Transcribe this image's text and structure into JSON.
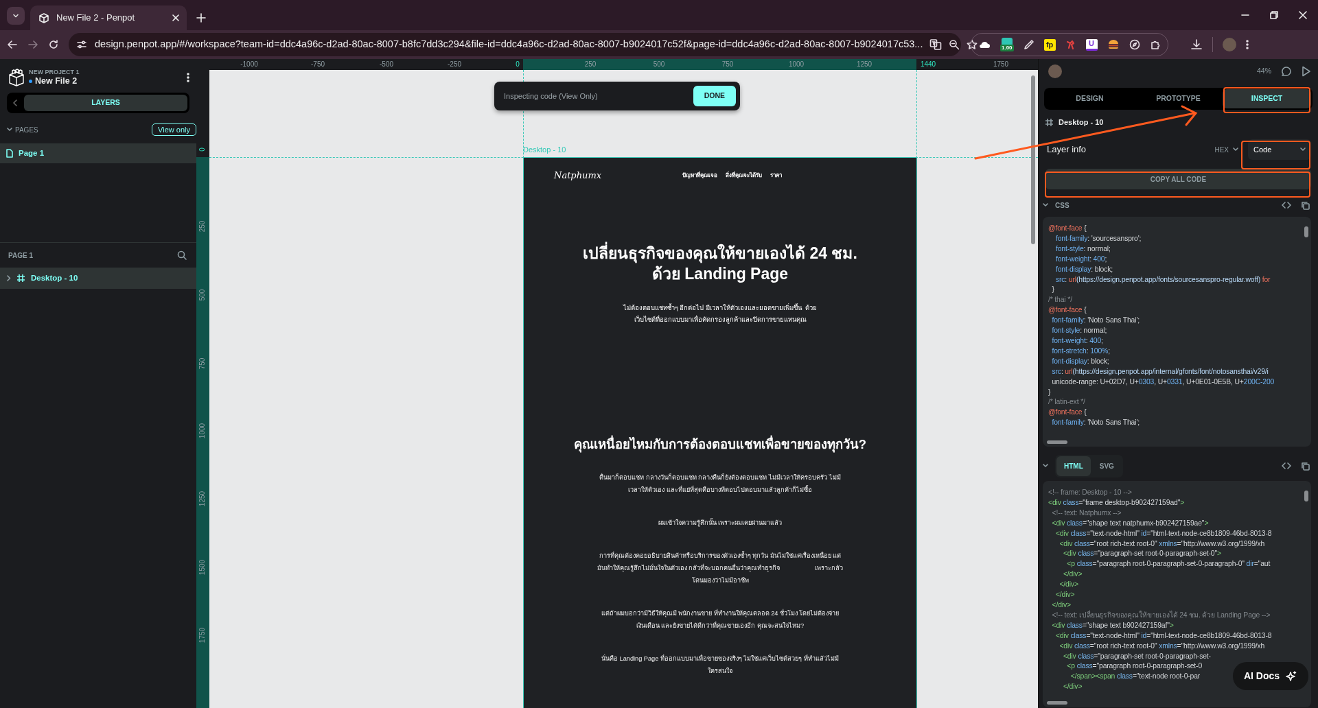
{
  "browser": {
    "tab_title": "New File 2 - Penpot",
    "url": "design.penpot.app/#/workspace?team-id=ddc4a96c-d2ad-80ac-8007-b8fc7dd3c294&file-id=ddc4a96c-d2ad-80ac-8007-b9024017c52f&page-id=ddc4a96c-d2ad-80ac-8007-b9024017c53...",
    "extension_badge": "1.00",
    "extension_fp": "fp",
    "extension_u": "U"
  },
  "sidebar": {
    "project": "NEW PROJECT 1",
    "file": "New File 2",
    "panel_tab": "LAYERS",
    "pages_label": "PAGES",
    "view_only": "View only",
    "pages": [
      {
        "name": "Page 1",
        "selected": true
      }
    ],
    "layers_title": "PAGE 1",
    "layers": [
      {
        "name": "Desktop - 10",
        "expanded": false,
        "selected": true
      }
    ]
  },
  "rulers": {
    "horizontal": [
      {
        "text": "-1000",
        "highlighted": false
      },
      {
        "text": "-750",
        "highlighted": false
      },
      {
        "text": "-500",
        "highlighted": false
      },
      {
        "text": "-250",
        "highlighted": false
      },
      {
        "text": "0",
        "highlighted": true
      },
      {
        "text": "250",
        "highlighted": false
      },
      {
        "text": "500",
        "highlighted": false
      },
      {
        "text": "750",
        "highlighted": false
      },
      {
        "text": "1000",
        "highlighted": false
      },
      {
        "text": "1250",
        "highlighted": false
      },
      {
        "text": "1440",
        "highlighted": true
      },
      {
        "text": "1750",
        "highlighted": false
      }
    ],
    "vertical": [
      {
        "text": "0",
        "highlighted": true
      },
      {
        "text": "250",
        "highlighted": false
      },
      {
        "text": "500",
        "highlighted": false
      },
      {
        "text": "750",
        "highlighted": false
      },
      {
        "text": "1000",
        "highlighted": false
      },
      {
        "text": "1250",
        "highlighted": false
      },
      {
        "text": "1500",
        "highlighted": false
      },
      {
        "text": "1750",
        "highlighted": false
      }
    ]
  },
  "canvas": {
    "toast": {
      "message": "Inspecting code (View Only)",
      "button": "DONE"
    },
    "frame": {
      "label": "Desktop - 10",
      "logo": "Natphumx",
      "nav": [
        "ปัญหาที่คุณเจอ",
        "สิ่งที่คุณจะได้รับ",
        "ราคา"
      ],
      "headline": "เปลี่ยนธุรกิจของคุณให้ขายเองได้ 24 ชม.\nด้วย Landing Page",
      "intro": "ไม่ต้องตอบแชทซ้ำๆ อีกต่อไป มีเวลาให้ตัวเองและยอดขายเพิ่มขึ้น  ด้วย\nเว็บไซต์ที่ออกแบบมาเพื่อคัดกรองลูกค้าและปิดการขายแทนคุณ",
      "heading": "คุณเหนื่อยไหมกับการต้องตอบแชทเพื่อขายของทุกวัน?",
      "paragraphs": [
        "ตื่นมาก็ตอบแชท กลางวันก็ตอบแชท กลางคืนก็ยังต้องตอบแชท ไม่มีเวลาให้ครอบครัว ไม่มี\nเวลาให้ตัวเอง และที่แย่ที่สุดคือบางทีตอบไปตอบมาแล้วลูกค้าก็ไม่ซื้อ",
        "ผมเข้าใจความรู้สึกนั้น เพราะผมเคยผ่านมาแล้ว",
        "การที่คุณต้องคอยอธิบายสินค้าหรือบริการของตัวเองซ้ำๆ ทุกวัน มันไม่ใช่แค่เรื่องเหนื่อย แต่\nมันทำให้คุณรู้สึกไม่มั่นใจในตัวเอง กลัวที่จะบอกคนอื่นว่าคุณทำธุรกิจ                    เพราะกลัว\nโดนมองว่าไม่มีอาชีพ",
        "แต่ถ้าผมบอกว่ามีวิธีให้คุณมี พนักงานขาย ที่ทำงานให้คุณตลอด 24 ชั่วโมง โดยไม่ต้องจ่าย\nเงินเดือน และยังขายได้ดีกว่าที่คุณขายเองอีก คุณจะสนใจไหม?",
        "นั่นคือ Landing Page ที่ออกแบบมาเพื่อขายของจริงๆ ไม่ใช่แค่เว็บไซต์สวยๆ ที่ทำแล้วไม่มี\nใครสนใจ"
      ]
    }
  },
  "inspector": {
    "zoom": "44%",
    "tabs": [
      {
        "label": "DESIGN",
        "selected": false
      },
      {
        "label": "PROTOTYPE",
        "selected": false
      },
      {
        "label": "INSPECT",
        "selected": true
      }
    ],
    "layer_name": "Desktop - 10",
    "layer_info": "Layer info",
    "color_format": "HEX",
    "view_mode": "Code",
    "copy_button": "COPY ALL CODE",
    "css": {
      "label": "CSS",
      "lines": [
        [
          {
            "kind": "at",
            "text": "@font-face"
          },
          {
            "kind": "plain",
            "text": " {"
          }
        ],
        [
          {
            "kind": "prop",
            "text": "    font-family"
          },
          {
            "kind": "plain",
            "text": ": 'sourcesanspro';"
          }
        ],
        [
          {
            "kind": "prop",
            "text": "    font-style"
          },
          {
            "kind": "plain",
            "text": ": normal;"
          }
        ],
        [
          {
            "kind": "prop",
            "text": "    font-weight"
          },
          {
            "kind": "plain",
            "text": ": "
          },
          {
            "kind": "num",
            "text": "400"
          },
          {
            "kind": "plain",
            "text": ";"
          }
        ],
        [
          {
            "kind": "prop",
            "text": "    font-display"
          },
          {
            "kind": "plain",
            "text": ": block;"
          }
        ],
        [
          {
            "kind": "prop",
            "text": "    src"
          },
          {
            "kind": "plain",
            "text": ": "
          },
          {
            "kind": "at",
            "text": "url"
          },
          {
            "kind": "link",
            "text": "(https://design.penpot.app/fonts/sourcesanspro-regular.woff)"
          },
          {
            "kind": "at",
            "text": " for"
          }
        ],
        [
          {
            "kind": "plain",
            "text": "  }"
          }
        ],
        [
          {
            "kind": "comment",
            "text": "/* thai */"
          }
        ],
        [
          {
            "kind": "at",
            "text": "@font-face"
          },
          {
            "kind": "plain",
            "text": " {"
          }
        ],
        [
          {
            "kind": "prop",
            "text": "  font-family"
          },
          {
            "kind": "plain",
            "text": ": 'Noto Sans Thai';"
          }
        ],
        [
          {
            "kind": "prop",
            "text": "  font-style"
          },
          {
            "kind": "plain",
            "text": ": normal;"
          }
        ],
        [
          {
            "kind": "prop",
            "text": "  font-weight"
          },
          {
            "kind": "plain",
            "text": ": "
          },
          {
            "kind": "num",
            "text": "400"
          },
          {
            "kind": "plain",
            "text": ";"
          }
        ],
        [
          {
            "kind": "prop",
            "text": "  font-stretch"
          },
          {
            "kind": "plain",
            "text": ": "
          },
          {
            "kind": "num",
            "text": "100%"
          },
          {
            "kind": "plain",
            "text": ";"
          }
        ],
        [
          {
            "kind": "prop",
            "text": "  font-display"
          },
          {
            "kind": "plain",
            "text": ": block;"
          }
        ],
        [
          {
            "kind": "prop",
            "text": "  src"
          },
          {
            "kind": "plain",
            "text": ": "
          },
          {
            "kind": "at",
            "text": "url"
          },
          {
            "kind": "link",
            "text": "(https://design.penpot.app/internal/gfonts/font/notosansthai/v29/i"
          }
        ],
        [
          {
            "kind": "plain",
            "text": "  unicode-range: U+02D7, U+"
          },
          {
            "kind": "num",
            "text": "0303"
          },
          {
            "kind": "plain",
            "text": ", U+"
          },
          {
            "kind": "num",
            "text": "0331"
          },
          {
            "kind": "plain",
            "text": ", U+0E01-0E5B, U+"
          },
          {
            "kind": "num",
            "text": "200C-200"
          }
        ],
        [
          {
            "kind": "plain",
            "text": "}"
          }
        ],
        [
          {
            "kind": "comment",
            "text": "/* latin-ext */"
          }
        ],
        [
          {
            "kind": "at",
            "text": "@font-face"
          },
          {
            "kind": "plain",
            "text": " {"
          }
        ],
        [
          {
            "kind": "prop",
            "text": "  font-family"
          },
          {
            "kind": "plain",
            "text": ": 'Noto Sans Thai';"
          }
        ]
      ]
    },
    "markup_tabs": [
      {
        "label": "HTML",
        "selected": true
      },
      {
        "label": "SVG",
        "selected": false
      }
    ],
    "html": {
      "lines": [
        [
          {
            "kind": "comment",
            "text": "<!-- frame: Desktop - 10 -->"
          }
        ],
        [
          {
            "kind": "tag",
            "text": "<div"
          },
          {
            "kind": "attr",
            "text": " class"
          },
          {
            "kind": "plain",
            "text": "=\"frame desktop-b902427159ad\""
          },
          {
            "kind": "tag",
            "text": ">"
          }
        ],
        [
          {
            "kind": "comment",
            "text": "  <!-- text: Natphumx -->"
          }
        ],
        [
          {
            "kind": "tag",
            "text": "  <div"
          },
          {
            "kind": "attr",
            "text": " class"
          },
          {
            "kind": "plain",
            "text": "=\"shape text natphumx-b902427159ae\""
          },
          {
            "kind": "tag",
            "text": ">"
          }
        ],
        [
          {
            "kind": "tag",
            "text": "    <div"
          },
          {
            "kind": "attr",
            "text": " class"
          },
          {
            "kind": "plain",
            "text": "=\"text-node-html\""
          },
          {
            "kind": "attr",
            "text": " id"
          },
          {
            "kind": "plain",
            "text": "=\"html-text-node-ce8b1809-46bd-8013-8"
          }
        ],
        [
          {
            "kind": "tag",
            "text": "      <div"
          },
          {
            "kind": "attr",
            "text": " class"
          },
          {
            "kind": "plain",
            "text": "=\"root rich-text root-0\""
          },
          {
            "kind": "attr",
            "text": " xmlns"
          },
          {
            "kind": "plain",
            "text": "=\"http://www.w3.org/1999/xh"
          }
        ],
        [
          {
            "kind": "tag",
            "text": "        <div"
          },
          {
            "kind": "attr",
            "text": " class"
          },
          {
            "kind": "plain",
            "text": "=\"paragraph-set root-0-paragraph-set-0\""
          },
          {
            "kind": "tag",
            "text": ">"
          }
        ],
        [
          {
            "kind": "tag",
            "text": "          <p"
          },
          {
            "kind": "attr",
            "text": " class"
          },
          {
            "kind": "plain",
            "text": "=\"paragraph root-0-paragraph-set-0-paragraph-0\""
          },
          {
            "kind": "attr",
            "text": " dir"
          },
          {
            "kind": "plain",
            "text": "=\"aut"
          }
        ],
        [
          {
            "kind": "tag",
            "text": "        </div>"
          }
        ],
        [
          {
            "kind": "tag",
            "text": "      </div>"
          }
        ],
        [
          {
            "kind": "tag",
            "text": "    </div>"
          }
        ],
        [
          {
            "kind": "tag",
            "text": "  </div>"
          }
        ],
        [
          {
            "kind": "comment",
            "text": "  <!-- text: เปลี่ยนธุรกิจของคุณให้ขายเองได้ 24 ชม. ด้วย Landing Page -->"
          }
        ],
        [
          {
            "kind": "tag",
            "text": "  <div"
          },
          {
            "kind": "attr",
            "text": " class"
          },
          {
            "kind": "plain",
            "text": "=\"shape text b902427159af\""
          },
          {
            "kind": "tag",
            "text": ">"
          }
        ],
        [
          {
            "kind": "tag",
            "text": "    <div"
          },
          {
            "kind": "attr",
            "text": " class"
          },
          {
            "kind": "plain",
            "text": "=\"text-node-html\""
          },
          {
            "kind": "attr",
            "text": " id"
          },
          {
            "kind": "plain",
            "text": "=\"html-text-node-ce8b1809-46bd-8013-8"
          }
        ],
        [
          {
            "kind": "tag",
            "text": "      <div"
          },
          {
            "kind": "attr",
            "text": " class"
          },
          {
            "kind": "plain",
            "text": "=\"root rich-text root-0\""
          },
          {
            "kind": "attr",
            "text": " xmlns"
          },
          {
            "kind": "plain",
            "text": "=\"http://www.w3.org/1999/xh"
          }
        ],
        [
          {
            "kind": "tag",
            "text": "        <div"
          },
          {
            "kind": "attr",
            "text": " class"
          },
          {
            "kind": "plain",
            "text": "=\"paragraph-set root-0-paragraph-set-"
          }
        ],
        [
          {
            "kind": "tag",
            "text": "          <p"
          },
          {
            "kind": "attr",
            "text": " class"
          },
          {
            "kind": "plain",
            "text": "=\"paragraph root-0-paragraph-set-0"
          }
        ],
        [
          {
            "kind": "tag",
            "text": "            </span><span"
          },
          {
            "kind": "attr",
            "text": " class"
          },
          {
            "kind": "plain",
            "text": "=\"text-node root-0-par"
          }
        ],
        [
          {
            "kind": "tag",
            "text": "        </div>"
          }
        ]
      ]
    },
    "ai_docs": "AI Docs"
  }
}
